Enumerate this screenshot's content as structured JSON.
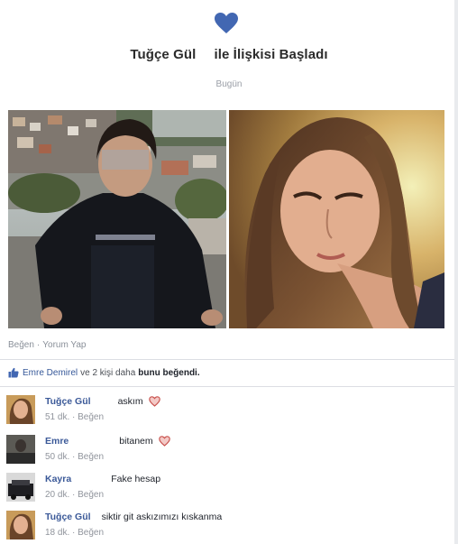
{
  "post": {
    "title_name": "Tuğçe Gül",
    "title_rest": "ile İlişkisi Başladı",
    "date": "Bugün",
    "actions": {
      "like": "Beğen",
      "separator": "·",
      "comment": "Yorum Yap"
    }
  },
  "likes": {
    "name": "Emre Demirel",
    "middle": "ve 2 kişi daha",
    "end": "bunu beğendi."
  },
  "comments": [
    {
      "name": "Tuğçe Gül",
      "text": "askım",
      "time": "51 dk.",
      "like": "Beğen",
      "heart": true
    },
    {
      "name": "Emre",
      "text": "bitanem",
      "time": "50 dk.",
      "like": "Beğen",
      "heart": true
    },
    {
      "name": "Kayra",
      "text": "Fake hesap",
      "time": "20 dk.",
      "like": "Beğen",
      "heart": false
    },
    {
      "name": "Tuğçe Gül",
      "text": "siktir git askızımızı kıskanma",
      "time": "18 dk.",
      "like": "Beğen",
      "heart": false
    }
  ],
  "colors": {
    "heart": "#3b5998",
    "link": "#3b5998",
    "muted": "#90949c"
  },
  "icons": {
    "top": "heart-icon",
    "like": "thumbs-up-icon",
    "comment_heart": "heart-icon"
  }
}
